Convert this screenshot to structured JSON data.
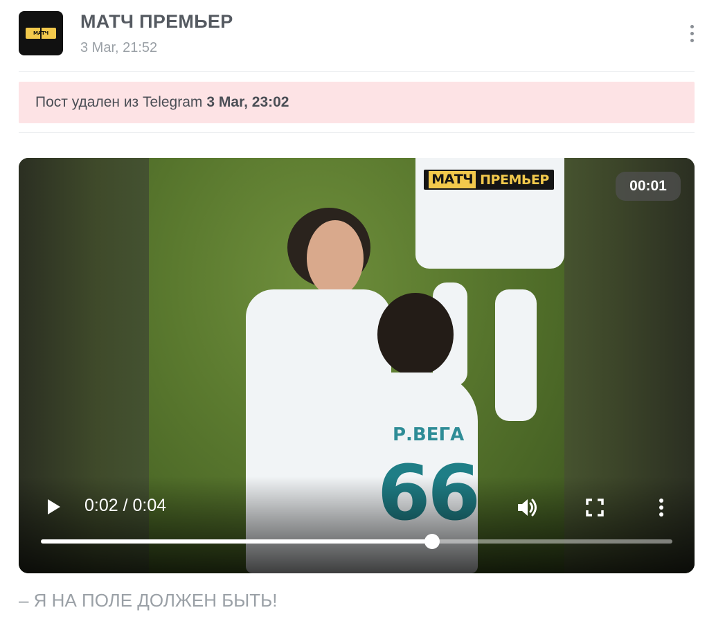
{
  "channel": {
    "name": "МАТЧ ПРЕМЬЕР",
    "timestamp": "3 Mar, 21:52"
  },
  "deleted_notice": {
    "text": "Пост удален из Telegram",
    "date": "3 Mar, 23:02"
  },
  "video": {
    "overlay_logo": [
      "МАТЧ",
      "ПРЕМЬЕР"
    ],
    "duration_badge": "00:01",
    "time_readout": "0:02 / 0:04",
    "progress_fraction": 0.62,
    "jersey_name": "Р.ВЕГА",
    "jersey_number": "66"
  },
  "caption": "– Я НА ПОЛЕ ДОЛЖЕН БЫТЬ!",
  "icons": {
    "menu": "more-vertical-icon",
    "play": "play-icon",
    "volume": "volume-icon",
    "fullscreen": "fullscreen-icon",
    "video_menu": "more-vertical-icon"
  },
  "colors": {
    "deleted_banner_bg": "#fde3e5",
    "logo_yellow": "#f2c94c"
  }
}
